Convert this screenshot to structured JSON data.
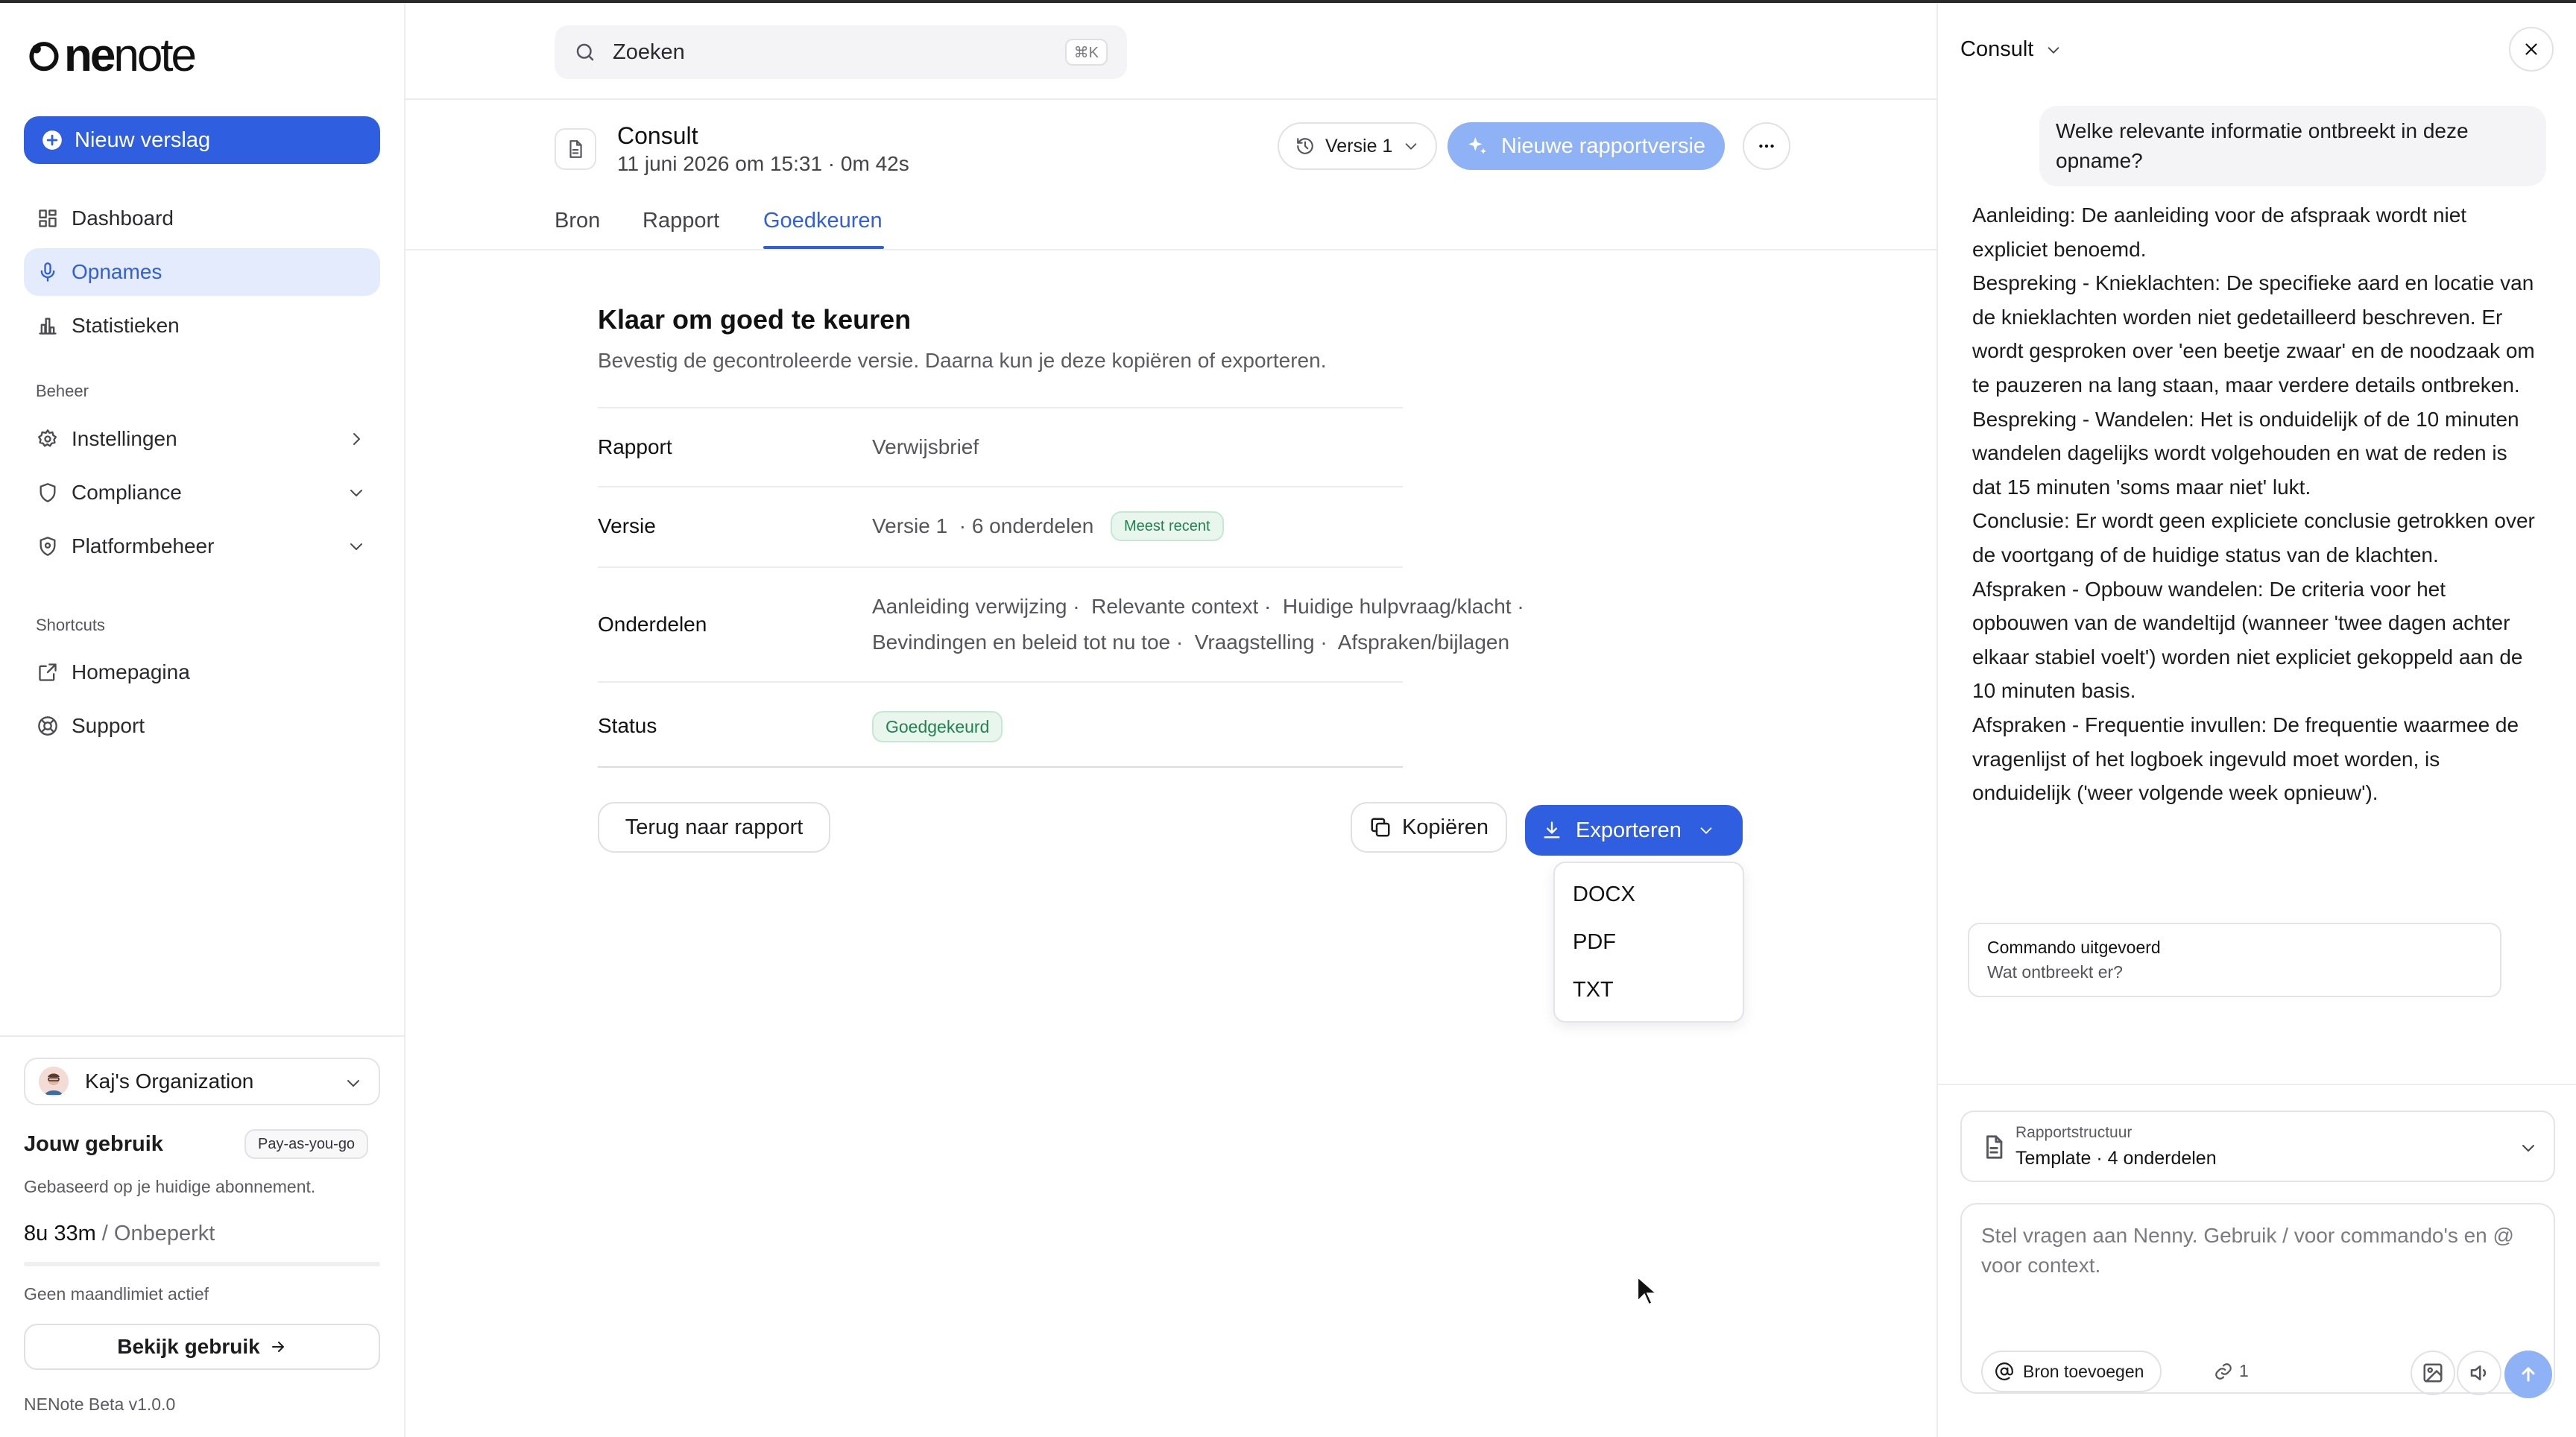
{
  "app": {
    "logo_bold": "ne",
    "logo_rest": "note",
    "logo_prefix": "o"
  },
  "sidebar": {
    "new_button": "Nieuw verslag",
    "nav": [
      {
        "label": "Dashboard",
        "icon": "grid-icon"
      },
      {
        "label": "Opnames",
        "icon": "microphone-icon",
        "active": true
      },
      {
        "label": "Statistieken",
        "icon": "bar-chart-icon"
      }
    ],
    "section_manage": "Beheer",
    "manage": [
      {
        "label": "Instellingen",
        "icon": "gear-icon",
        "chevron": "right"
      },
      {
        "label": "Compliance",
        "icon": "shield-check-icon",
        "chevron": "down"
      },
      {
        "label": "Platformbeheer",
        "icon": "shield-icon",
        "chevron": "down"
      }
    ],
    "section_shortcuts": "Shortcuts",
    "shortcuts": [
      {
        "label": "Homepagina",
        "icon": "external-link-icon"
      },
      {
        "label": "Support",
        "icon": "lifebuoy-icon"
      }
    ],
    "org": "Kaj's Organization",
    "usage_title": "Jouw gebruik",
    "usage_plan": "Pay-as-you-go",
    "usage_sub": "Gebaseerd op je huidige abonnement.",
    "usage_used": "8u 33m",
    "usage_limit": "/ Onbeperkt",
    "no_limit": "Geen maandlimiet actief",
    "view_usage": "Bekijk gebruik",
    "version": "NENote Beta v1.0.0"
  },
  "header": {
    "search_placeholder": "Zoeken",
    "search_shortcut": "⌘K",
    "doc_title": "Consult",
    "doc_meta": "11 juni 2026 om 15:31 · 0m 42s",
    "version_button": "Versie 1",
    "new_version_button": "Nieuwe rapportversie",
    "tabs": [
      "Bron",
      "Rapport",
      "Goedkeuren"
    ],
    "active_tab": "Goedkeuren"
  },
  "approve": {
    "title": "Klaar om goed te keuren",
    "subtitle": "Bevestig de gecontroleerde versie. Daarna kun je deze kopiëren of exporteren.",
    "rows": {
      "report_label": "Rapport",
      "report_value": "Verwijsbrief",
      "version_label": "Versie",
      "version_value": "Versie 1  · 6 onderdelen",
      "version_badge": "Meest recent",
      "parts_label": "Onderdelen",
      "parts_line1": "Aanleiding verwijzing ·  Relevante context ·  Huidige hulpvraag/klacht ·",
      "parts_line2": "Bevindingen en beleid tot nu toe ·  Vraagstelling ·  Afspraken/bijlagen",
      "status_label": "Status",
      "status_value": "Goedgekeurd"
    },
    "back_button": "Terug naar rapport",
    "copy_button": "Kopiëren",
    "export_button": "Exporteren",
    "export_options": [
      "DOCX",
      "PDF",
      "TXT"
    ]
  },
  "panel": {
    "title": "Consult",
    "question": "Welke relevante informatie ontbreekt in deze opname?",
    "answer": [
      "Aanleiding: De aanleiding voor de afspraak wordt niet expliciet benoemd.",
      "Bespreking - Knieklachten: De specifieke aard en locatie van de knieklachten worden niet gedetailleerd beschreven. Er wordt gesproken over 'een beetje zwaar' en de noodzaak om te pauzeren na lang staan, maar verdere details ontbreken.",
      "Bespreking - Wandelen: Het is onduidelijk of de 10 minuten wandelen dagelijks wordt volgehouden en wat de reden is dat 15 minuten 'soms maar niet' lukt.",
      "Conclusie: Er wordt geen expliciete conclusie getrokken over de voortgang of de huidige status van de klachten.",
      "Afspraken - Opbouw wandelen: De criteria voor het opbouwen van de wandeltijd (wanneer 'twee dagen achter elkaar stabiel voelt') worden niet expliciet gekoppeld aan de 10 minuten basis.",
      "Afspraken - Frequentie invullen: De frequentie waarmee de vragenlijst of het logboek ingevuld moet worden, is onduidelijk ('weer volgende week opnieuw')."
    ],
    "command_title": "Commando uitgevoerd",
    "command_sub": "Wat ontbreekt er?",
    "structure_label": "Rapportstructuur",
    "structure_value": "Template · 4 onderdelen",
    "composer_placeholder": "Stel vragen aan Nenny. Gebruik / voor commando's en @ voor context.",
    "source_button": "Bron toevoegen",
    "link_count": "1"
  }
}
